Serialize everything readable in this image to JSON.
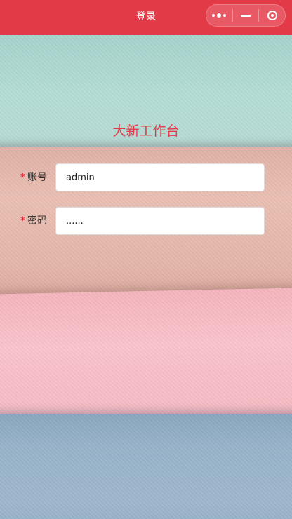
{
  "nav": {
    "title": "登录",
    "menu_icon": "more-dots-icon",
    "minimize_icon": "minimize-icon",
    "close_icon": "target-circle-icon"
  },
  "brand": {
    "title": "大新工作台"
  },
  "form": {
    "account_required": "*",
    "account_label": "账号",
    "account_value": "admin",
    "password_required": "*",
    "password_label": "密码",
    "password_value": "......"
  },
  "colors": {
    "navbar": "#e33a48",
    "brand_text": "#e33a48",
    "required": "#e3152c"
  }
}
